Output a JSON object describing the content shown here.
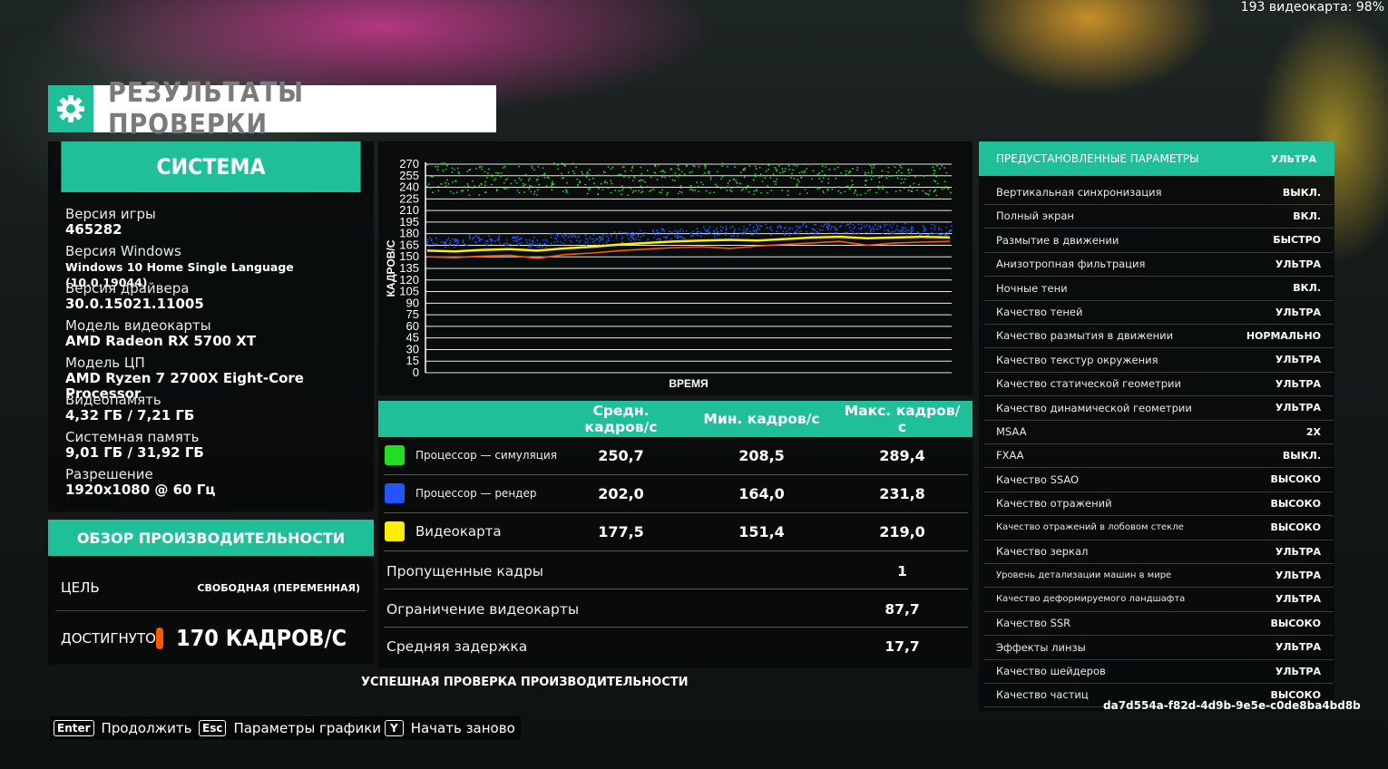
{
  "overlay": {
    "fps_status": "193 видеокарта: 98%"
  },
  "title": "РЕЗУЛЬТАТЫ ПРОВЕРКИ",
  "system": {
    "heading": "СИСТЕМА",
    "rows": [
      {
        "label": "Версия игры",
        "value": "465282"
      },
      {
        "label": "Версия Windows",
        "value": "Windows 10 Home Single Language (10.0.19044)"
      },
      {
        "label": "Версия драйвера",
        "value": "30.0.15021.11005"
      },
      {
        "label": "Модель видеокарты",
        "value": "AMD Radeon RX 5700 XT"
      },
      {
        "label": "Модель ЦП",
        "value": "AMD Ryzen 7 2700X Eight-Core Processor"
      },
      {
        "label": "Видеопамять",
        "value": "4,32 ГБ / 7,21 ГБ"
      },
      {
        "label": "Системная память",
        "value": "9,01 ГБ / 31,92 ГБ"
      },
      {
        "label": "Разрешение",
        "value": "1920x1080 @ 60 Гц"
      }
    ]
  },
  "overview": {
    "heading": "ОБЗОР ПРОИЗВОДИТЕЛЬНОСТИ",
    "target_label": "ЦЕЛЬ",
    "target_value": "СВОБОДНАЯ (ПЕРЕМЕННАЯ)",
    "achieved_label": "ДОСТИГНУТО",
    "achieved_value": "170 КАДРОВ/С",
    "achieved_color": "#ff5a00"
  },
  "chart_data": {
    "type": "line",
    "ylabel": "КАДРОВ/С",
    "xlabel": "ВРЕМЯ",
    "ylim": [
      0,
      270
    ],
    "yticks": [
      0,
      15,
      30,
      45,
      60,
      75,
      90,
      105,
      120,
      135,
      150,
      165,
      180,
      195,
      210,
      225,
      240,
      255,
      270
    ],
    "grid": true,
    "series": [
      {
        "color": "#22dd22",
        "style": "scatter",
        "values": [
          250,
          252,
          249,
          251,
          250,
          253,
          250,
          248,
          251,
          250,
          252,
          251,
          250,
          249,
          251,
          252,
          250,
          251,
          250,
          249
        ]
      },
      {
        "color": "#2255ff",
        "style": "scatter",
        "values": [
          170,
          168,
          172,
          171,
          169,
          174,
          172,
          175,
          178,
          180,
          182,
          183,
          185,
          184,
          186,
          187,
          185,
          186,
          185,
          184
        ]
      },
      {
        "color": "#ffee00",
        "style": "line",
        "values": [
          158,
          157,
          159,
          160,
          158,
          161,
          163,
          166,
          168,
          170,
          171,
          172,
          171,
          173,
          175,
          176,
          174,
          175,
          176,
          175
        ]
      },
      {
        "color": "#ff5a00",
        "style": "line",
        "values": [
          150,
          149,
          151,
          152,
          148,
          153,
          155,
          158,
          160,
          162,
          163,
          161,
          164,
          166,
          168,
          170,
          165,
          168,
          169,
          170
        ]
      }
    ]
  },
  "stats": {
    "headers": [
      "Средн. кадров/с",
      "Мин. кадров/с",
      "Макс. кадров/с"
    ],
    "rows": [
      {
        "name": "Процессор — симуляция",
        "color": "#22dd22",
        "avg": "250,7",
        "min": "208,5",
        "max": "289,4"
      },
      {
        "name": "Процессор — рендер",
        "color": "#2255ff",
        "avg": "202,0",
        "min": "164,0",
        "max": "231,8"
      },
      {
        "name": "Видеокарта",
        "color": "#ffee00",
        "avg": "177,5",
        "min": "151,4",
        "max": "219,0"
      }
    ],
    "metrics": [
      {
        "name": "Пропущенные кадры",
        "value": "1"
      },
      {
        "name": "Ограничение видеокарты",
        "value": "87,7"
      },
      {
        "name": "Средняя задержка",
        "value": "17,7"
      }
    ],
    "success": "УСПЕШНАЯ ПРОВЕРКА ПРОИЗВОДИТЕЛЬНОСТИ"
  },
  "settings": {
    "preset_label": "ПРЕДУСТАНОВЛЕННЫЕ ПАРАМЕТРЫ",
    "preset_value": "УЛЬТРА",
    "rows": [
      {
        "name": "Вертикальная синхронизация",
        "value": "ВЫКЛ."
      },
      {
        "name": "Полный экран",
        "value": "ВКЛ."
      },
      {
        "name": "Размытие в движении",
        "value": "БЫСТРО"
      },
      {
        "name": "Анизотропная фильтрация",
        "value": "УЛЬТРА"
      },
      {
        "name": "Ночные тени",
        "value": "ВКЛ."
      },
      {
        "name": "Качество теней",
        "value": "УЛЬТРА"
      },
      {
        "name": "Качество размытия в движении",
        "value": "НОРМАЛЬНО"
      },
      {
        "name": "Качество текстур окружения",
        "value": "УЛЬТРА"
      },
      {
        "name": "Качество статической геометрии",
        "value": "УЛЬТРА"
      },
      {
        "name": "Качество динамической геометрии",
        "value": "УЛЬТРА"
      },
      {
        "name": "MSAA",
        "value": "2X"
      },
      {
        "name": "FXAA",
        "value": "ВЫКЛ."
      },
      {
        "name": "Качество SSAO",
        "value": "ВЫСОКО"
      },
      {
        "name": "Качество отражений",
        "value": "ВЫСОКО"
      },
      {
        "name": "Качество отражений в лобовом стекле",
        "value": "ВЫСОКО"
      },
      {
        "name": "Качество зеркал",
        "value": "УЛЬТРА"
      },
      {
        "name": "Уровень детализации машин в мире",
        "value": "УЛЬТРА"
      },
      {
        "name": "Качество деформируемого ландшафта",
        "value": "УЛЬТРА"
      },
      {
        "name": "Качество SSR",
        "value": "ВЫСОКО"
      },
      {
        "name": "Эффекты линзы",
        "value": "УЛЬТРА"
      },
      {
        "name": "Качество шейдеров",
        "value": "УЛЬТРА"
      },
      {
        "name": "Качество частиц",
        "value": "ВЫСОКО"
      }
    ],
    "uuid": "da7d554a-f82d-4d9b-9e5e-c0de8ba4bd8b"
  },
  "footer": {
    "continue_key": "Enter",
    "continue_label": "Продолжить",
    "graphics_key": "Esc",
    "graphics_label": "Параметры графики",
    "restart_key": "Y",
    "restart_label": "Начать заново"
  }
}
